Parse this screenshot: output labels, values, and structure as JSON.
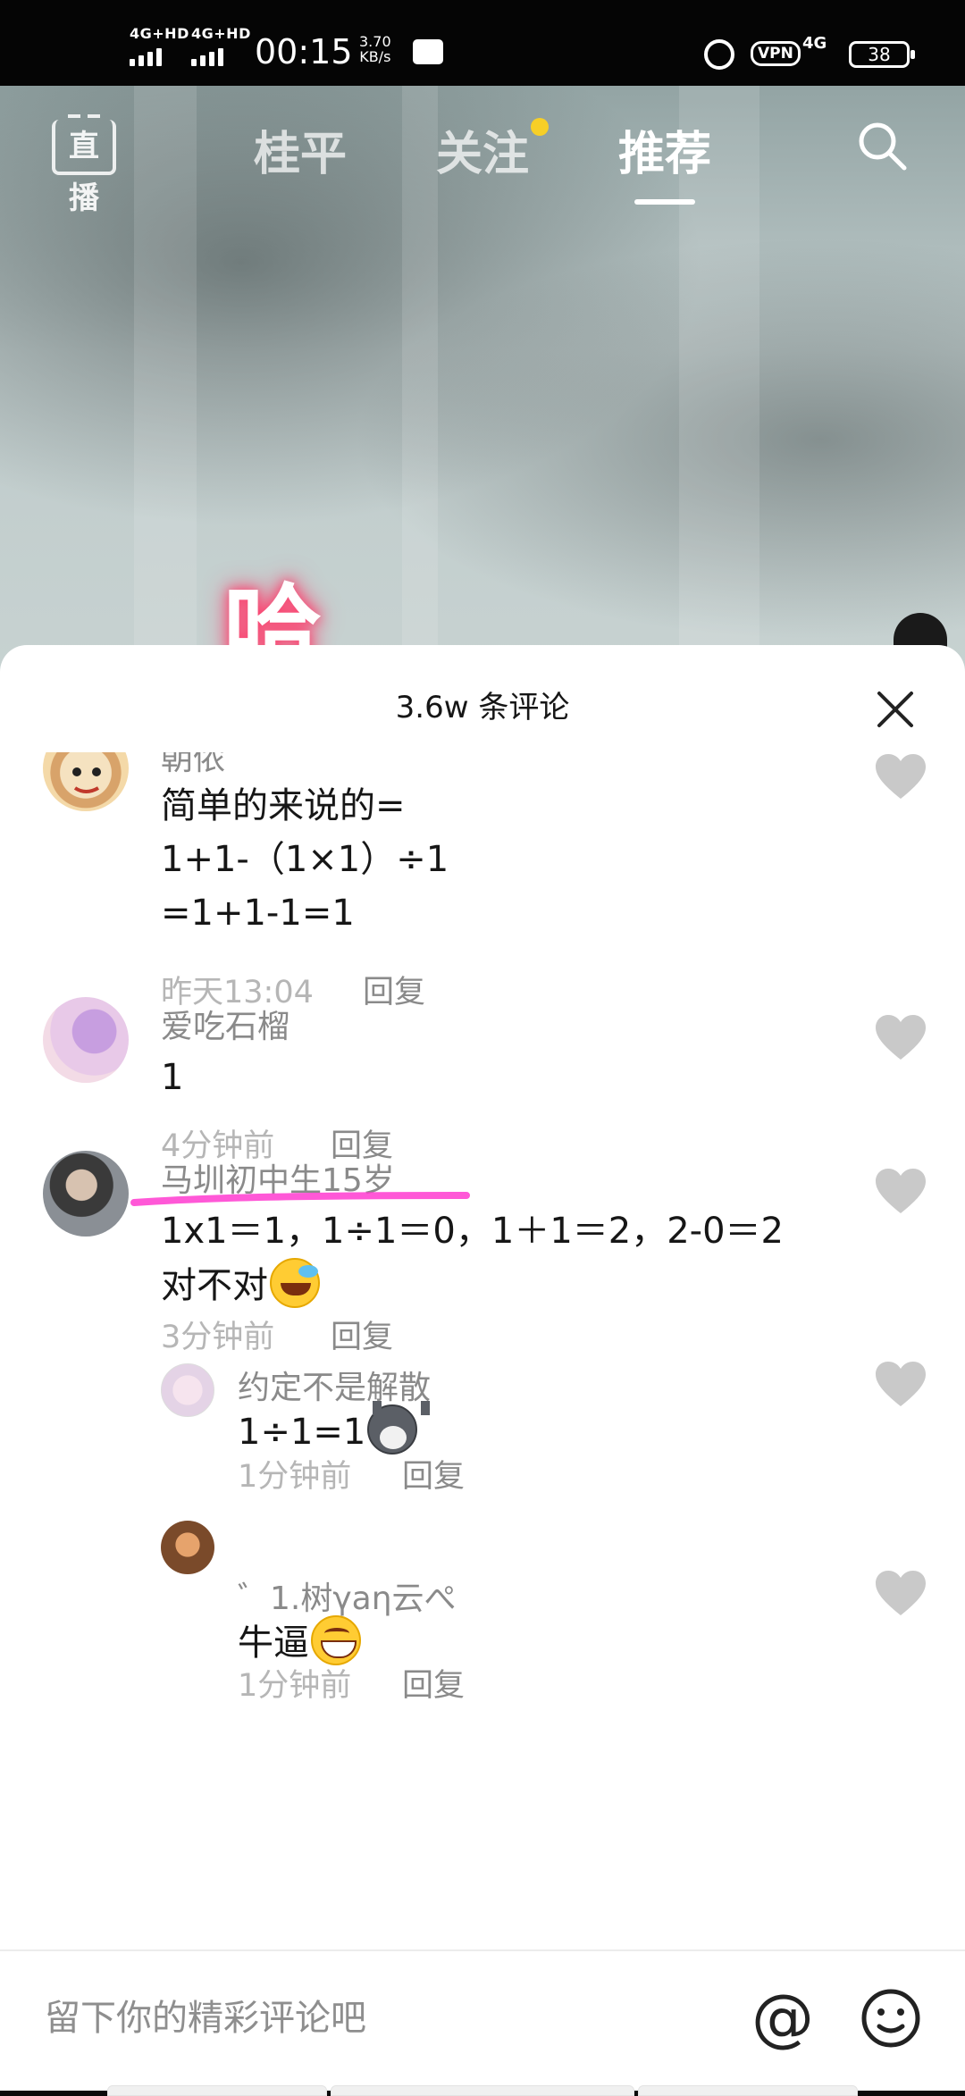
{
  "status_bar": {
    "signal1": "4G+HD",
    "signal2": "4G+HD",
    "time": "00:15",
    "speed_value": "3.70",
    "speed_unit": "KB/s",
    "vpn": "VPN",
    "network": "4G",
    "battery": "38"
  },
  "top_nav": {
    "live_label": "直播",
    "tabs": [
      "桂平",
      "关注",
      "推荐"
    ],
    "active_tab": "推荐"
  },
  "video": {
    "overlay_text": "哈"
  },
  "comments": {
    "title": "3.6w 条评论",
    "items": [
      {
        "username": "朝侬",
        "lines": [
          "简单的来说的=",
          "1+1-（1×1）÷1",
          "=1+1-1=1"
        ],
        "time": "昨天13:04",
        "reply": "回复"
      },
      {
        "username": "爱吃石榴",
        "lines": [
          "1"
        ],
        "time": "4分钟前",
        "reply": "回复"
      },
      {
        "username": "马圳初中生15岁",
        "lines": [
          "1x1＝1，1÷1＝0，1＋1＝2，2-0＝2",
          "对不对"
        ],
        "emoji": "laughing-with-tear",
        "time": "3分钟前",
        "reply": "回复"
      },
      {
        "username": "约定不是解散",
        "lines": [
          "1÷1=1"
        ],
        "emoji": "husky-dog",
        "time": "1分钟前",
        "reply": "回复",
        "nested": true
      },
      {
        "username": "゛1.树γaη云ぺ",
        "lines": [
          "牛逼"
        ],
        "emoji": "grinning-face",
        "time": "1分钟前",
        "reply": "回复",
        "nested": true
      }
    ]
  },
  "input": {
    "placeholder": "留下你的精彩评论吧",
    "at_symbol": "@"
  },
  "colors": {
    "highlight_pink": "#ff3bd0",
    "notification_dot": "#f7cf27"
  }
}
